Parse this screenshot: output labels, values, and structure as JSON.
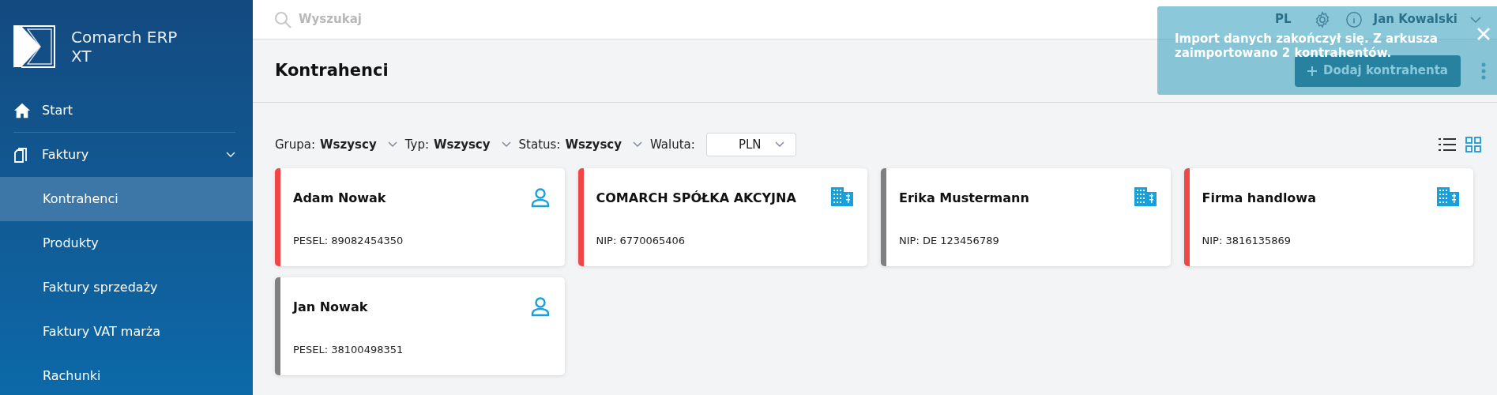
{
  "sidebar": {
    "logo_text": "Comarch ERP XT",
    "items": [
      {
        "label": "Start",
        "kind": "home",
        "selected": false
      },
      {
        "label": "Faktury",
        "kind": "documents",
        "selected": false,
        "expanded": true,
        "children": [
          {
            "label": "Kontrahenci",
            "selected": true
          },
          {
            "label": "Produkty",
            "selected": false
          },
          {
            "label": "Faktury sprzedaży",
            "selected": false
          },
          {
            "label": "Faktury VAT marża",
            "selected": false
          },
          {
            "label": "Rachunki",
            "selected": false
          }
        ]
      }
    ]
  },
  "topbar": {
    "search": {
      "placeholder": "Wyszukaj"
    },
    "language": "PL",
    "user": "Jan Kowalski"
  },
  "page": {
    "title": "Kontrahenci",
    "add_button": "Dodaj kontrahenta"
  },
  "filters": [
    {
      "kind": "dropdown",
      "label": "Grupa:",
      "value": "Wszyscy"
    },
    {
      "kind": "dropdown",
      "label": "Typ:",
      "value": "Wszyscy"
    },
    {
      "kind": "dropdown",
      "label": "Status:",
      "value": "Wszyscy"
    },
    {
      "kind": "select",
      "label": "Waluta:",
      "value": "PLN"
    }
  ],
  "view_toggle": [
    {
      "kind": "list",
      "selected": false
    },
    {
      "kind": "grid",
      "selected": true
    }
  ],
  "cards": [
    {
      "name": "Adam Nowak",
      "kind": "person",
      "id_text": "PESEL: 89082454350",
      "color": "#f04646"
    },
    {
      "name": "COMARCH SPÓŁKA AKCYJNA",
      "kind": "company",
      "id_text": "NIP: 6770065406",
      "color": "#f04646"
    },
    {
      "name": "Erika Mustermann",
      "kind": "company",
      "id_text": "NIP: DE 123456789",
      "color": "#808080"
    },
    {
      "name": "Firma handlowa",
      "kind": "company",
      "id_text": "NIP: 3816135869",
      "color": "#f04646"
    },
    {
      "name": "Jan Nowak",
      "kind": "person",
      "id_text": "PESEL: 38100498351",
      "color": "#808080"
    }
  ],
  "toast": {
    "message": "Import danych zakończył się. Z arkusza zaimportowano 2 kontrahentów."
  }
}
